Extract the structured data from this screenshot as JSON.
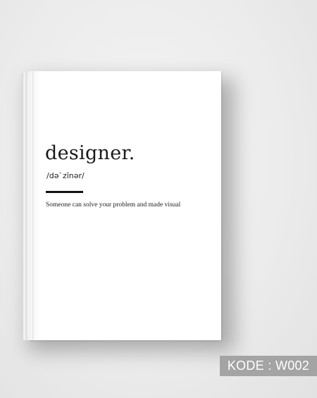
{
  "book": {
    "word": "designer.",
    "pronunciation": "/də`zīnər/",
    "definition": "Someone can solve your problem and made visual"
  },
  "badge": {
    "text": "KODE : W002"
  },
  "colors": {
    "background": "#ececec",
    "cover": "#ffffff",
    "text": "#1a1a1a",
    "badge_bg": "#a4a4a4",
    "badge_text": "#ffffff"
  }
}
